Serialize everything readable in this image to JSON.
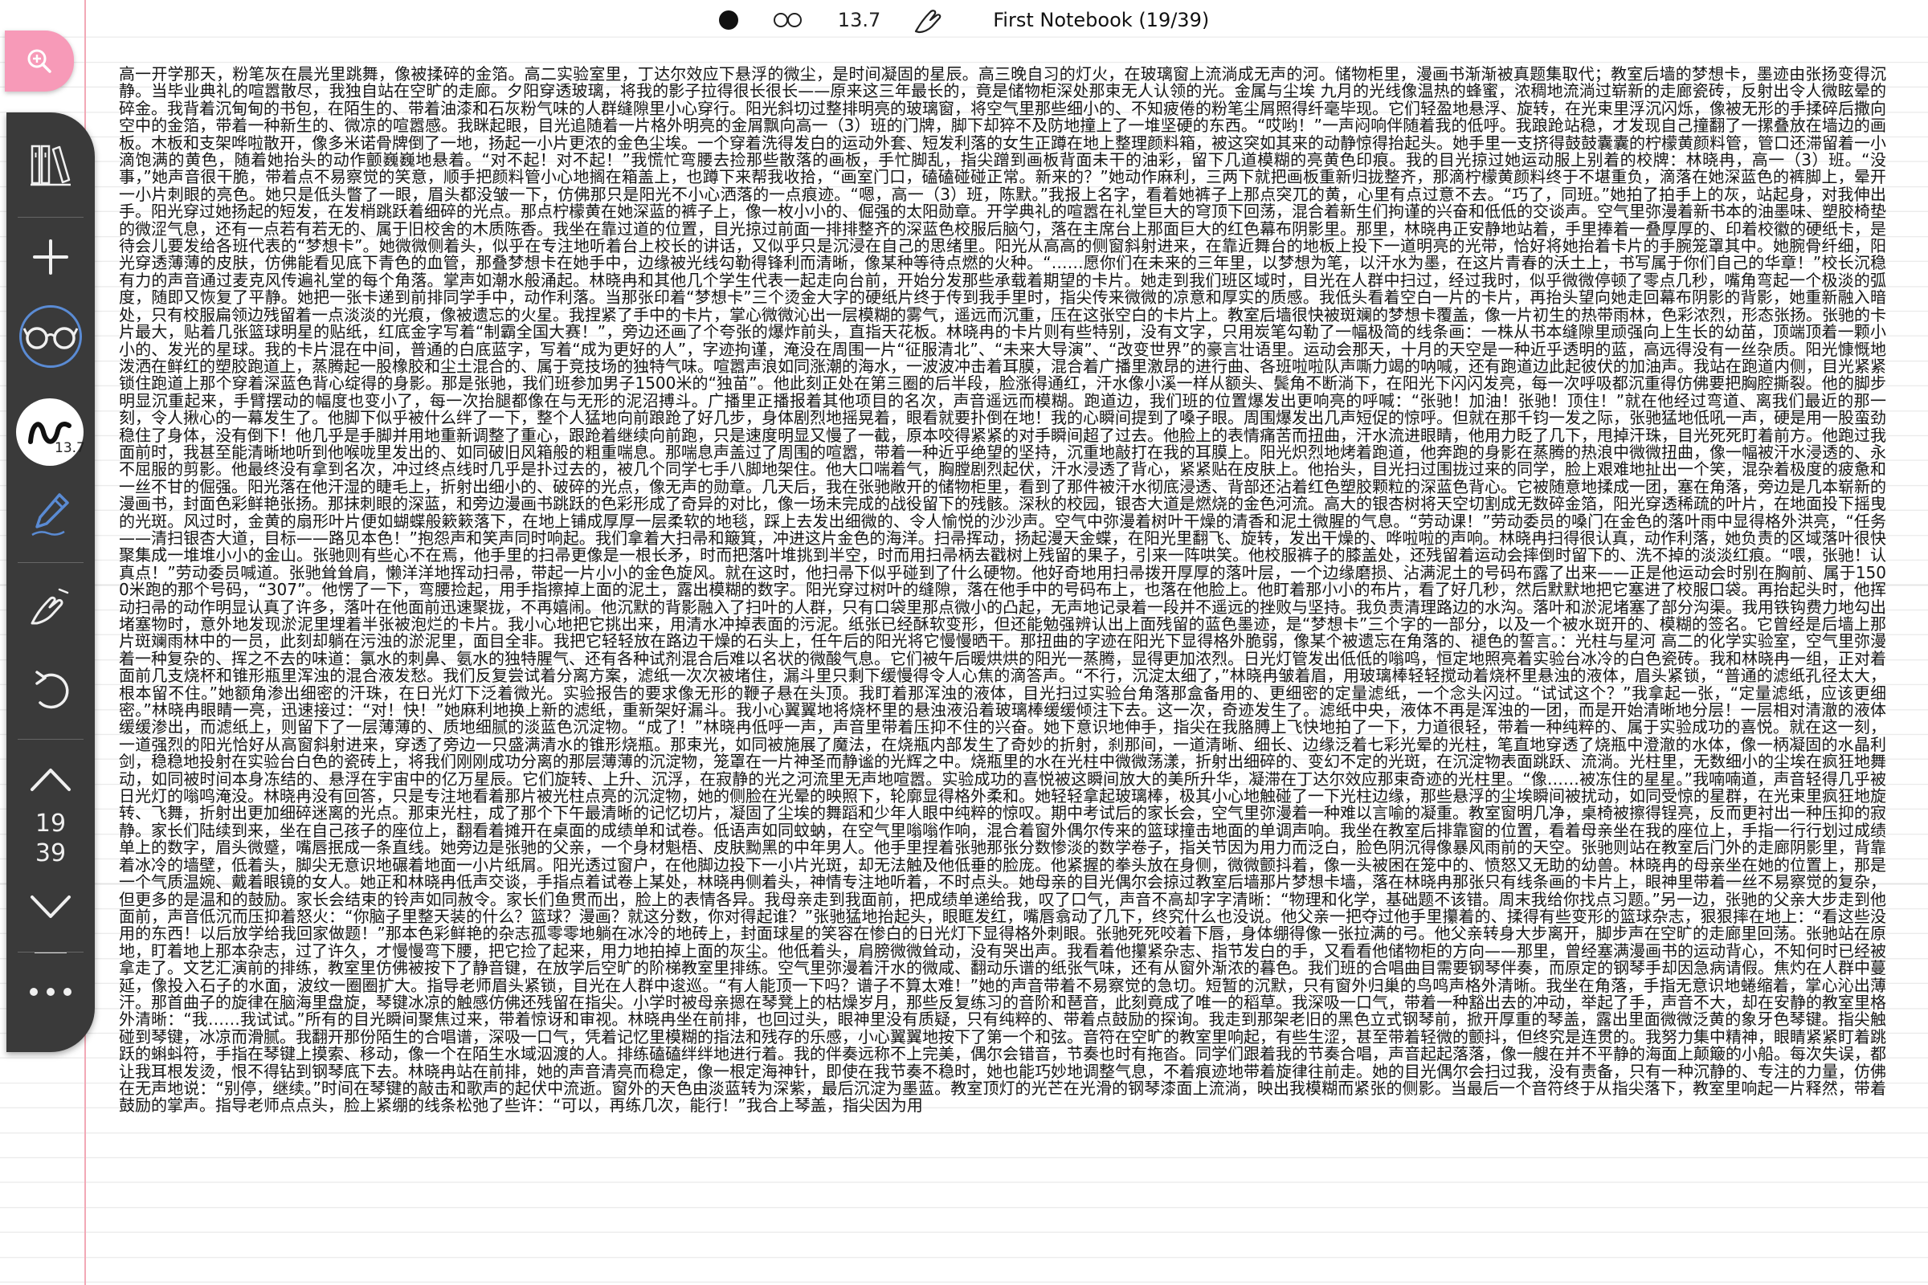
{
  "header": {
    "pen_size": "13.7",
    "notebook_title": "First Notebook (19/39)"
  },
  "toolbar": {
    "pen_badge_size": "13.7",
    "page_current": "19",
    "page_total": "39"
  },
  "icons": {
    "zoom": "zoom-in-icon",
    "library": "library-icon",
    "add": "add-page-icon",
    "read_mode": "glasses-icon",
    "pen_style": "pen-style-icon",
    "highlighter": "highlighter-icon",
    "eraser": "eraser-hand-icon",
    "undo": "undo-icon",
    "page_up": "chevron-up-icon",
    "page_down": "chevron-down-icon",
    "more": "more-icon"
  },
  "colors": {
    "zoom_button": "#f79ab8",
    "toolbar": "#3a3a3a",
    "margin_line": "#f2a9b6",
    "read_mode_ring": "#5a8bd4",
    "pen_tool": "#5a8bd4"
  },
  "page": {
    "text": "高一开学那天，粉笔灰在晨光里跳舞，像被揉碎的金箔。高二实验室里，丁达尔效应下悬浮的微尘，是时间凝固的星辰。高三晚自习的灯火，在玻璃窗上流淌成无声的河。储物柜里，漫画书渐渐被真题集取代；教室后墙的梦想卡，墨迹由张扬变得沉静。当毕业典礼的喧嚣散尽，我独自站在空旷的走廊。夕阳穿透玻璃，将我的影子拉得很长很长——原来这三年最长的，竟是储物柜深处那束无人认领的光。金属与尘埃 九月的光线像温热的蜂蜜，浓稠地流淌过崭新的走廊瓷砖，反射出令人微眩晕的碎金。我背着沉甸甸的书包，在陌生的、带着油漆和石灰粉气味的人群缝隙里小心穿行。阳光斜切过整排明亮的玻璃窗，将空气里那些细小的、不知疲倦的粉笔尘屑照得纤毫毕现。它们轻盈地悬浮、旋转，在光束里浮沉闪烁，像被无形的手揉碎后撒向空中的金箔，带着一种新生的、微凉的喧嚣感。我眯起眼，目光追随着一片格外明亮的金屑飘向高一（3）班的门牌，脚下却猝不及防地撞上了一堆坚硬的东西。“哎哟！”一声闷响伴随着我的低呼。我踉跄站稳，才发现自己撞翻了一摞叠放在墙边的画板。木板和支架哗啦散开，像多米诺骨牌倒了一地，扬起一小片更浓的金色尘埃。一个穿着洗得发白的运动外套、短发利落的女生正蹲在地上整理颜料箱，被这突如其来的动静惊得抬起头。她手里一支挤得鼓鼓囊囊的柠檬黄颜料管，管口还滞留着一小滴饱满的黄色，随着她抬头的动作颤巍巍地悬着。“对不起！对不起！”我慌忙弯腰去捡那些散落的画板，手忙脚乱，指尖蹭到画板背面未干的油彩，留下几道模糊的亮黄色印痕。我的目光掠过她运动服上别着的校牌：林晓冉，高一（3）班。“没事，”她声音很干脆，带着点不易察觉的笑意，顺手把颜料管小心地搁在箱盖上，也蹲下来帮我收拾，“画室门口，磕磕碰碰正常。新来的？”她动作麻利，三两下就把画板重新归拢整齐，那滴柠檬黄颜料终于不堪重负，滴落在她深蓝色的裤脚上，晕开一小片刺眼的亮色。她只是低头瞥了一眼，眉头都没皱一下，仿佛那只是阳光不小心洒落的一点痕迹。“嗯，高一（3）班，陈默。”我报上名字，看着她裤子上那点突兀的黄，心里有点过意不去。“巧了，同班。”她拍了拍手上的灰，站起身，对我伸出手。阳光穿过她扬起的短发，在发梢跳跃着细碎的光点。那点柠檬黄在她深蓝的裤子上，像一枚小小的、倔强的太阳勋章。开学典礼的喧嚣在礼堂巨大的穹顶下回荡，混合着新生们拘谨的兴奋和低低的交谈声。空气里弥漫着新书本的油墨味、塑胶椅垫的微涩气息，还有一点若有若无的、属于旧校舍的木质陈香。我坐在靠过道的位置，目光掠过前面一排排整齐的深蓝色校服后脑勺，落在主席台上那面巨大的红色幕布阴影里。那里，林晓冉正安静地站着，手里捧着一叠厚厚的、印着校徽的硬纸卡，是待会儿要发给各班代表的“梦想卡”。她微微侧着头，似乎在专注地听着台上校长的讲话，又似乎只是沉浸在自己的思绪里。阳光从高高的侧窗斜射进来，在靠近舞台的地板上投下一道明亮的光带，恰好将她抬着卡片的手腕笼罩其中。她腕骨纤细，阳光穿透薄薄的皮肤，仿佛能看见底下青色的血管，那叠梦想卡在她手中，边缘被光线勾勒得锋利而清晰，像某种等待点燃的火种。“……愿你们在未来的三年里，以梦想为笔，以汗水为墨，在这片青春的沃土上，书写属于你们自己的华章！”校长沉稳有力的声音通过麦克风传遍礼堂的每个角落。掌声如潮水般涌起。林晓冉和其他几个学生代表一起走向台前，开始分发那些承载着期望的卡片。她走到我们班区域时，目光在人群中扫过，经过我时，似乎微微停顿了零点几秒，嘴角弯起一个极淡的弧度，随即又恢复了平静。她把一张卡递到前排同学手中，动作利落。当那张印着“梦想卡”三个烫金大字的硬纸片终于传到我手里时，指尖传来微微的凉意和厚实的质感。我低头看着空白一片的卡片，再抬头望向她走回幕布阴影的背影，她重新融入暗处，只有校服扁领边残留着一点淡淡的光痕，像被遗忘的火星。我捏紧了手中的卡片，掌心微微沁出一层模糊的雾气，遥远而沉重，压在这张空白的卡片上。教室后墙很快被斑斓的梦想卡覆盖，像一片初生的热带雨林，色彩浓烈，形态张扬。张驰的卡片最大，贴着几张篮球明星的贴纸，红底金字写着“制霸全国大赛！”，旁边还画了个夸张的爆炸前头，直指天花板。林晓冉的卡片则有些特别，没有文字，只用炭笔勾勒了一幅极简的线条画：一株从书本缝隙里顽强向上生长的幼苗，顶端顶着一颗小小的、发光的星球。我的卡片混在中间，普通的白底蓝字，写着“成为更好的人”，字迹拘谨，淹没在周围一片“征服清北”、“未来大导演”、“改变世界”的豪言壮语里。运动会那天，十月的天空是一种近乎透明的蓝，高远得没有一丝杂质。阳光慷慨地泼洒在鲜红的塑胶跑道上，蒸腾起一股橡胶和尘土混合的、属于竞技场的独特气味。喧嚣声浪如同涨潮的海水，一波波冲击着耳膜，混合着广播里激昂的进行曲、各班啦啦队声嘶力竭的呐喊，还有跑道边此起彼伏的加油声。我站在跑道内侧，目光紧紧锁住跑道上那个穿着深蓝色背心绽得的身影。那是张驰，我们班参加男子1500米的“独苗”。他此刻正处在第三圈的后半段，脸涨得通红，汗水像小溪一样从额头、鬓角不断淌下，在阳光下闪闪发亮，每一次呼吸都沉重得仿佛要把胸腔撕裂。他的脚步明显沉重起来，手臂摆动的幅度也变小了，每一次抬腿都像在与无形的泥沼搏斗。广播里正播报着其他项目的名次，声音遥远而模糊。跑道边，我们班的位置爆发出更响亮的呼喊：“张驰！加油！张驰！顶住！”就在他经过弯道、离我们最近的那一刻，令人揪心的一幕发生了。他脚下似乎被什么绊了一下，整个人猛地向前踉跄了好几步，身体剧烈地摇晃着，眼看就要扑倒在地！我的心瞬间提到了嗓子眼。周围爆发出几声短促的惊呼。但就在那千钧一发之际，张驰猛地低吼一声，硬是用一股蛮劲稳住了身体，没有倒下！他几乎是手脚并用地重新调整了重心，跟跄着继续向前跑，只是速度明显又慢了一截，原本咬得紧紧的对手瞬间超了过去。他脸上的表情痛苦而扭曲，汗水流进眼睛，他用力眨了几下，甩掉汗珠，目光死死盯着前方。他跑过我面前时，我甚至能清晰地听到他喉咙里发出的、如同破旧风箱般的粗重喘息。那喘息声盖过了周围的喧嚣，带着一种近乎绝望的坚持，沉重地敲打在我的耳膜上。阳光炽烈地烤着跑道，他奔跑的身影在蒸腾的热浪中微微扭曲，像一幅被汗水浸透的、永不屈服的剪影。他最终没有拿到名次，冲过终点线时几乎是扑过去的，被几个同学七手八脚地架住。他大口喘着气，胸膛剧烈起伏，汗水浸透了背心，紧紧贴在皮肤上。他抬头，目光扫过围拢过来的同学，脸上艰难地扯出一个笑，混杂着极度的疲惫和一丝不甘的倔强。阳光落在他汗湿的睫毛上，折射出细小的、破碎的光点，像无声的勋章。几天后，我在张驰敞开的储物柜里，看到了那件被汗水彻底浸透、背部还沾着红色塑胶颗粒的深蓝色背心。它被随意地揉成一团，塞在角落，旁边是几本崭新的漫画书，封面色彩鲜艳张扬。那抹刺眼的深蓝，和旁边漫画书跳跃的色彩形成了奇异的对比，像一场未完成的战役留下的残骸。深秋的校园，银杏大道是燃烧的金色河流。高大的银杏树将天空切割成无数碎金箔，阳光穿透稀疏的叶片，在地面投下摇曳的光斑。风过时，金黄的扇形叶片便如蝴蝶般簌簌落下，在地上铺成厚厚一层柔软的地毯，踩上去发出细微的、令人愉悦的沙沙声。空气中弥漫着树叶干燥的清香和泥土微腥的气息。“劳动课！”劳动委员的嗓门在金色的落叶雨中显得格外洪亮，“任务——清扫银杏大道，目标——路见本色！”抱怨声和笑声同时响起。我们拿着大扫帚和簸箕，冲进这片金色的海洋。扫帚挥动，扬起漫天金蝶，在阳光里翻飞、旋转，发出干燥的、哗啦啦的声响。林晓冉扫得很认真，动作利落，她负责的区域落叶很快聚集成一堆堆小小的金山。张驰则有些心不在焉，他手里的扫帚更像是一根长矛，时而把落叶堆挑到半空，时而用扫帚柄去戳树上残留的果子，引来一阵哄笑。他校服裤子的膝盖处，还残留着运动会摔倒时留下的、洗不掉的淡淡红痕。“喂，张驰！认真点！”劳动委员喊道。张驰耸耸肩，懒洋洋地挥动扫帚，带起一片小小的金色旋风。就在这时，他扫帚下似乎碰到了什么硬物。他好奇地用扫帚拨开厚厚的落叶层，一个边缘磨损、沾满泥土的号码布露了出来——正是他运动会时别在胸前、属于1500米跑的那个号码，“307”。他愣了一下，弯腰捡起，用手指擦掉上面的泥土，露出模糊的数字。阳光穿过树叶的缝隙，落在他手中的号码布上，也落在他脸上。他盯着那小小的布片，看了好几秒，然后默默地把它塞进了校服口袋。再抬起头时，他挥动扫帚的动作明显认真了许多，落叶在他面前迅速聚拢，不再嬉闹。他沉默的背影融入了扫叶的人群，只有口袋里那点微小的凸起，无声地记录着一段并不遥远的挫败与坚持。我负责清理路边的水沟。落叶和淤泥堵塞了部分沟渠。我用铁钩费力地勾出堵塞物时，意外地发现淤泥里埋着半张被泡烂的卡片。我小心地把它挑出来，用清水冲掉表面的污泥。纸张已经酥软变形，但还能勉强辨认出上面残留的蓝色墨迹，是“梦想卡”三个字的一部分，以及一个被水斑开的、模糊的签名。它曾经是后墙上那片斑斓雨林中的一员，此刻却躺在污浊的淤泥里，面目全非。我把它轻轻放在路边干燥的石头上，任午后的阳光将它慢慢晒干。那扭曲的字迹在阳光下显得格外脆弱，像某个被遗忘在角落的、褪色的誓言。：光柱与星河 高二的化学实验室，空气里弥漫着一种复杂的、挥之不去的味道：氯水的刺鼻、氨水的独特腥气、还有各种试剂混合后难以名状的微酸气息。它们被午后暖烘烘的阳光一蒸腾，显得更加浓烈。日光灯管发出低低的嗡鸣，恒定地照亮着实验台冰冷的白色瓷砖。我和林晓冉一组，正对着面前几支烧杯和锥形瓶里浑浊的混合液发愁。我们反复尝试着分离方案，滤纸一次次被堵住，漏斗里只剩下缓慢得令人心焦的滴答声。“不行，沉淀太细了，”林晓冉皱着眉，用玻璃棒轻轻搅动着烧杯里悬浊的液体，眉头紧锁，“普通的滤纸孔径太大，根本留不住。”她额角渗出细密的汗珠，在日光灯下泛着微光。实验报告的要求像无形的鞭子悬在头顶。我盯着那浑浊的液体，目光扫过实验台角落那盒备用的、更细密的定量滤纸，一个念头闪过。“试试这个？”我拿起一张，“定量滤纸，应该更细密。”林晓冉眼睛一亮，迅速接过：“对！快！”她麻利地换上新的滤纸，重新架好漏斗。我小心翼翼地将烧杯里的悬浊液沿着玻璃棒缓缓倾注下去。这一次，奇迹发生了。滤纸中央，液体不再是浑浊的一团，而是开始清晰地分层！一层相对清澈的液体缓缓渗出，而滤纸上，则留下了一层薄薄的、质地细腻的淡蓝色沉淀物。“成了！”林晓冉低呼一声，声音里带着压抑不住的兴奋。她下意识地伸手，指尖在我胳膊上飞快地拍了一下，力道很轻，带着一种纯粹的、属于实验成功的喜悦。就在这一刻，一道强烈的阳光恰好从高窗斜射进来，穿透了旁边一只盛满清水的锥形烧瓶。那束光，如同被施展了魔法，在烧瓶内部发生了奇妙的折射，刹那间，一道清晰、细长、边缘泛着七彩光晕的光柱，笔直地穿透了烧瓶中澄澈的水体，像一柄凝固的水晶利剑，稳稳地投射在实验台白色的瓷砖上，将我们刚刚成功分离的那层薄薄的沉淀物，笼罩在一片神圣而静谧的光辉之中。烧瓶里的水在光柱中微微荡漾，折射出细碎的、变幻不定的光斑，在沉淀物表面跳跃、流淌。光柱里，无数细小的尘埃在疯狂地舞动，如同被时间本身冻结的、悬浮在宇宙中的亿万星辰。它们旋转、上升、沉浮，在寂静的光之河流里无声地喧嚣。实验成功的喜悦被这瞬间放大的美所升华，凝滞在丁达尔效应那束奇迹的光柱里。“像……被冻住的星星。”我喃喃道，声音轻得几乎被日光灯的嗡鸣淹没。林晓冉没有回答，只是专注地看着那片被光柱点亮的沉淀物，她的侧脸在光晕的映照下，轮廓显得格外柔和。她轻轻拿起玻璃棒，极其小心地触碰了一下光柱边缘，那些悬浮的尘埃瞬间被扰动，如同受惊的星群，在光束里疯狂地旋转、飞舞，折射出更加细碎迷离的光点。那束光柱，成了那个下午最清晰的记忆切片，凝固了尘埃的舞蹈和少年人眼中纯粹的惊叹。期中考试后的家长会，空气里弥漫着一种难以言喻的凝重。教室窗明几净，桌椅被擦得锃亮，反而更衬出一种压抑的寂静。家长们陆续到来，坐在自己孩子的座位上，翻看着摊开在桌面的成绩单和试卷。低语声如同蚊蚋，在空气里嗡嗡作响，混合着窗外偶尔传来的篮球撞击地面的单调声响。我坐在教室后排靠窗的位置，看着母亲坐在我的座位上，手指一行行划过成绩单上的数字，眉头微蹙，嘴唇抿成一条直线。她旁边是张驰的父亲，一个身材魁梧、皮肤黝黑的中年男人。他手里捏着张驰那张分数惨淡的数学卷子，指关节因为用力而泛白，脸色阴沉得像暴风雨前的天空。张驰则站在教室后门外的走廊阴影里，背靠着冰冷的墙壁，低着头，脚尖无意识地碾着地面一小片纸屑。阳光透过窗户，在他脚边投下一小片光斑，却无法触及他低垂的脸庞。他紧握的拳头放在身侧，微微颤抖着，像一头被困在笼中的、愤怒又无助的幼兽。林晓冉的母亲坐在她的位置上，那是一个气质温婉、戴着眼镜的女人。她正和林晓冉低声交谈，手指点着试卷上某处，林晓冉侧着头，神情专注地听着，不时点头。她母亲的目光偶尔会掠过教室后墙那片梦想卡墙，落在林晓冉那张只有线条画的卡片上，眼神里带着一丝不易察觉的复杂，但更多的是温和的鼓励。家长会结束的铃声如同赦令。家长们鱼贯而出，脸上的表情各异。我母亲走到我面前，把成绩单递给我，叹了口气，声音不高却字字清晰：“物理和化学，基础题不该错。周末我给你找点习题。”另一边，张驰的父亲大步走到他面前，声音低沉而压抑着怒火：“你脑子里整天装的什么？篮球？漫画？就这分数，你对得起谁？”张驰猛地抬起头，眼眶发红，嘴唇翕动了几下，终究什么也没说。他父亲一把夺过他手里攥着的、揉得有些变形的篮球杂志，狠狠摔在地上：“看这些没用的东西！以后放学给我回家做题！”那本色彩鲜艳的杂志孤零零地躺在冰冷的地砖上，封面球星的笑容在惨白的日光灯下显得格外刺眼。张驰死死咬着下唇，身体绷得像一张拉满的弓。他父亲转身大步离开，脚步声在空旷的走廊里回荡。张驰站在原地，盯着地上那本杂志，过了许久，才慢慢弯下腰，把它捡了起来，用力地拍掉上面的灰尘。他低着头，肩膀微微耸动，没有哭出声。我看着他攥紧杂志、指节发白的手，又看看他储物柜的方向——那里，曾经塞满漫画书的运动背心，不知何时已经被拿走了。文艺汇演前的排练，教室里仿佛被按下了静音键，在放学后空旷的阶梯教室里排练。空气里弥漫着汗水的微咸、翻动乐谱的纸张气味，还有从窗外渐浓的暮色。我们班的合唱曲目需要钢琴伴奏，而原定的钢琴手却因急病请假。焦灼在人群中蔓延，像投入石子的水面，波纹一圈圈扩大。指导老师眉头紧锁，目光在人群中逡巡。“有人能顶一下吗？谱子不算太难！”她的声音带着不易察觉的急切。短暂的沉默，只有窗外归巢的鸟鸣声格外清晰。我坐在角落，手指无意识地蜷缩着，掌心沁出薄汗。那首曲子的旋律在脑海里盘旋，琴键冰凉的触感仿佛还残留在指尖。小学时被母亲摁在琴凳上的枯燥岁月，那些反复练习的音阶和琶音，此刻竟成了唯一的稻草。我深吸一口气，带着一种豁出去的冲动，举起了手，声音不大，却在安静的教室里格外清晰：“我……我试试。”所有的目光瞬间聚焦过来，带着惊讶和审视。林晓冉坐在前排，也回过头，眼神里没有质疑，只有纯粹的、带着点鼓励的探询。我走到那架老旧的黑色立式钢琴前，掀开厚重的琴盖，露出里面微微泛黄的象牙色琴键。指尖触碰到琴键，冰凉而滑腻。我翻开那份陌生的合唱谱，深吸一口气，凭着记忆里模糊的指法和残存的乐感，小心翼翼地按下了第一个和弦。音符在空旷的教室里响起，有些生涩，甚至带着轻微的颤抖，但终究是连贯的。我努力集中精神，眼睛紧紧盯着跳跃的蝌蚪符，手指在琴键上摸索、移动，像一个在陌生水域泅渡的人。排练磕磕绊绊地进行着。我的伴奏远称不上完美，偶尔会错音，节奏也时有拖沓。同学们跟着我的节奏合唱，声音起起落落，像一艘在并不平静的海面上颠簸的小船。每次失误，都让我耳根发烫，恨不得钻到钢琴底下去。林晓冉站在前排，她的声音清亮而稳定，像一根定海神针，即使在我节奏不稳时，她也能巧妙地调整气息，不着痕迹地带着旋律往前走。她的目光偶尔会扫过我，没有责备，只有一种沉静的、专注的力量，仿佛在无声地说：“别停，继续。”时间在琴键的敲击和歌声的起伏中流逝。窗外的天色由淡蓝转为深紫，最后沉淀为墨蓝。教室顶灯的光芒在光滑的钢琴漆面上流淌，映出我模糊而紧张的侧影。当最后一个音符终于从指尖落下，教室里响起一片释然，带着鼓励的掌声。指导老师点点头，脸上紧绷的线条松弛了些许：“可以，再练几次，能行！”我合上琴盖，指尖因为用"
  }
}
